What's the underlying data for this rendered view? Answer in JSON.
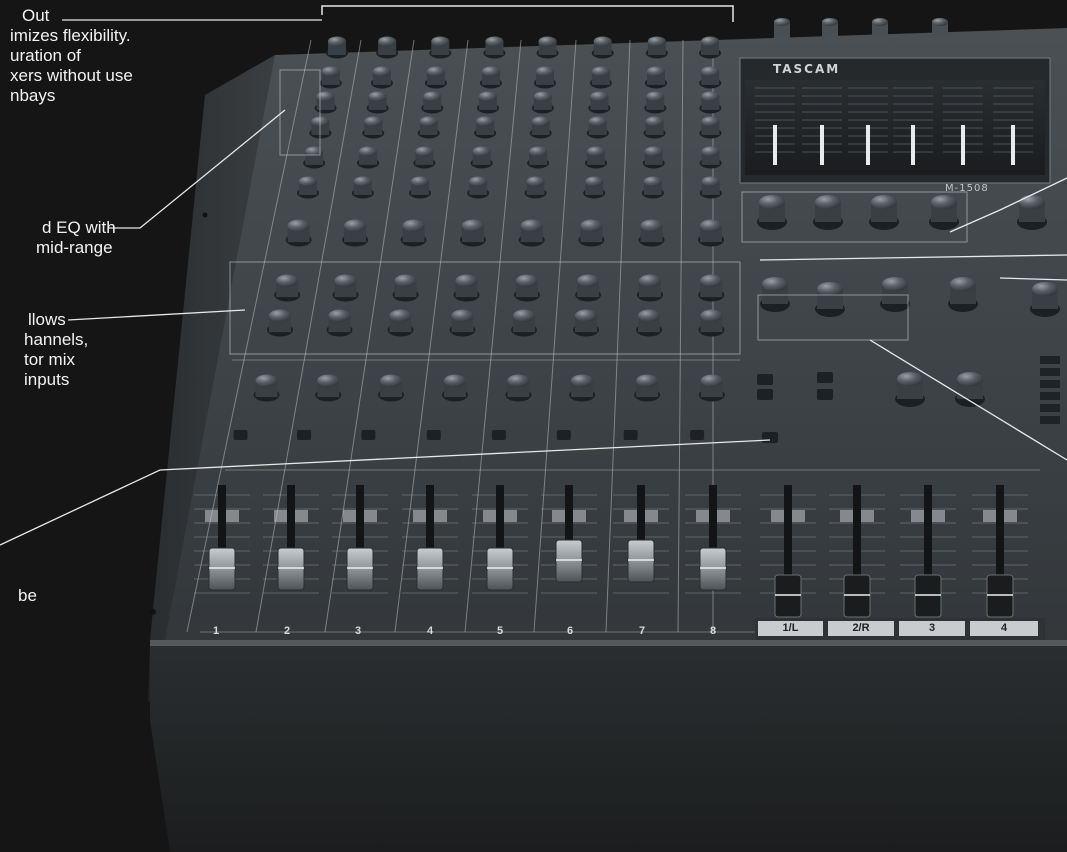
{
  "product": {
    "brand": "TASCAM",
    "model": "M-1508"
  },
  "callouts": [
    {
      "lines": [
        "Out",
        "imizes flexibility.",
        "uration of",
        "xers without use",
        "nbays"
      ]
    },
    {
      "lines": [
        "d EQ with",
        "mid-range"
      ]
    },
    {
      "lines": [
        "llows",
        "hannels,",
        "tor mix",
        "inputs"
      ]
    },
    {
      "lines": [
        "be"
      ]
    }
  ],
  "channels": [
    "1",
    "2",
    "3",
    "4",
    "5",
    "6",
    "7",
    "8"
  ],
  "buses": [
    "1/L",
    "2/R",
    "3",
    "4"
  ]
}
